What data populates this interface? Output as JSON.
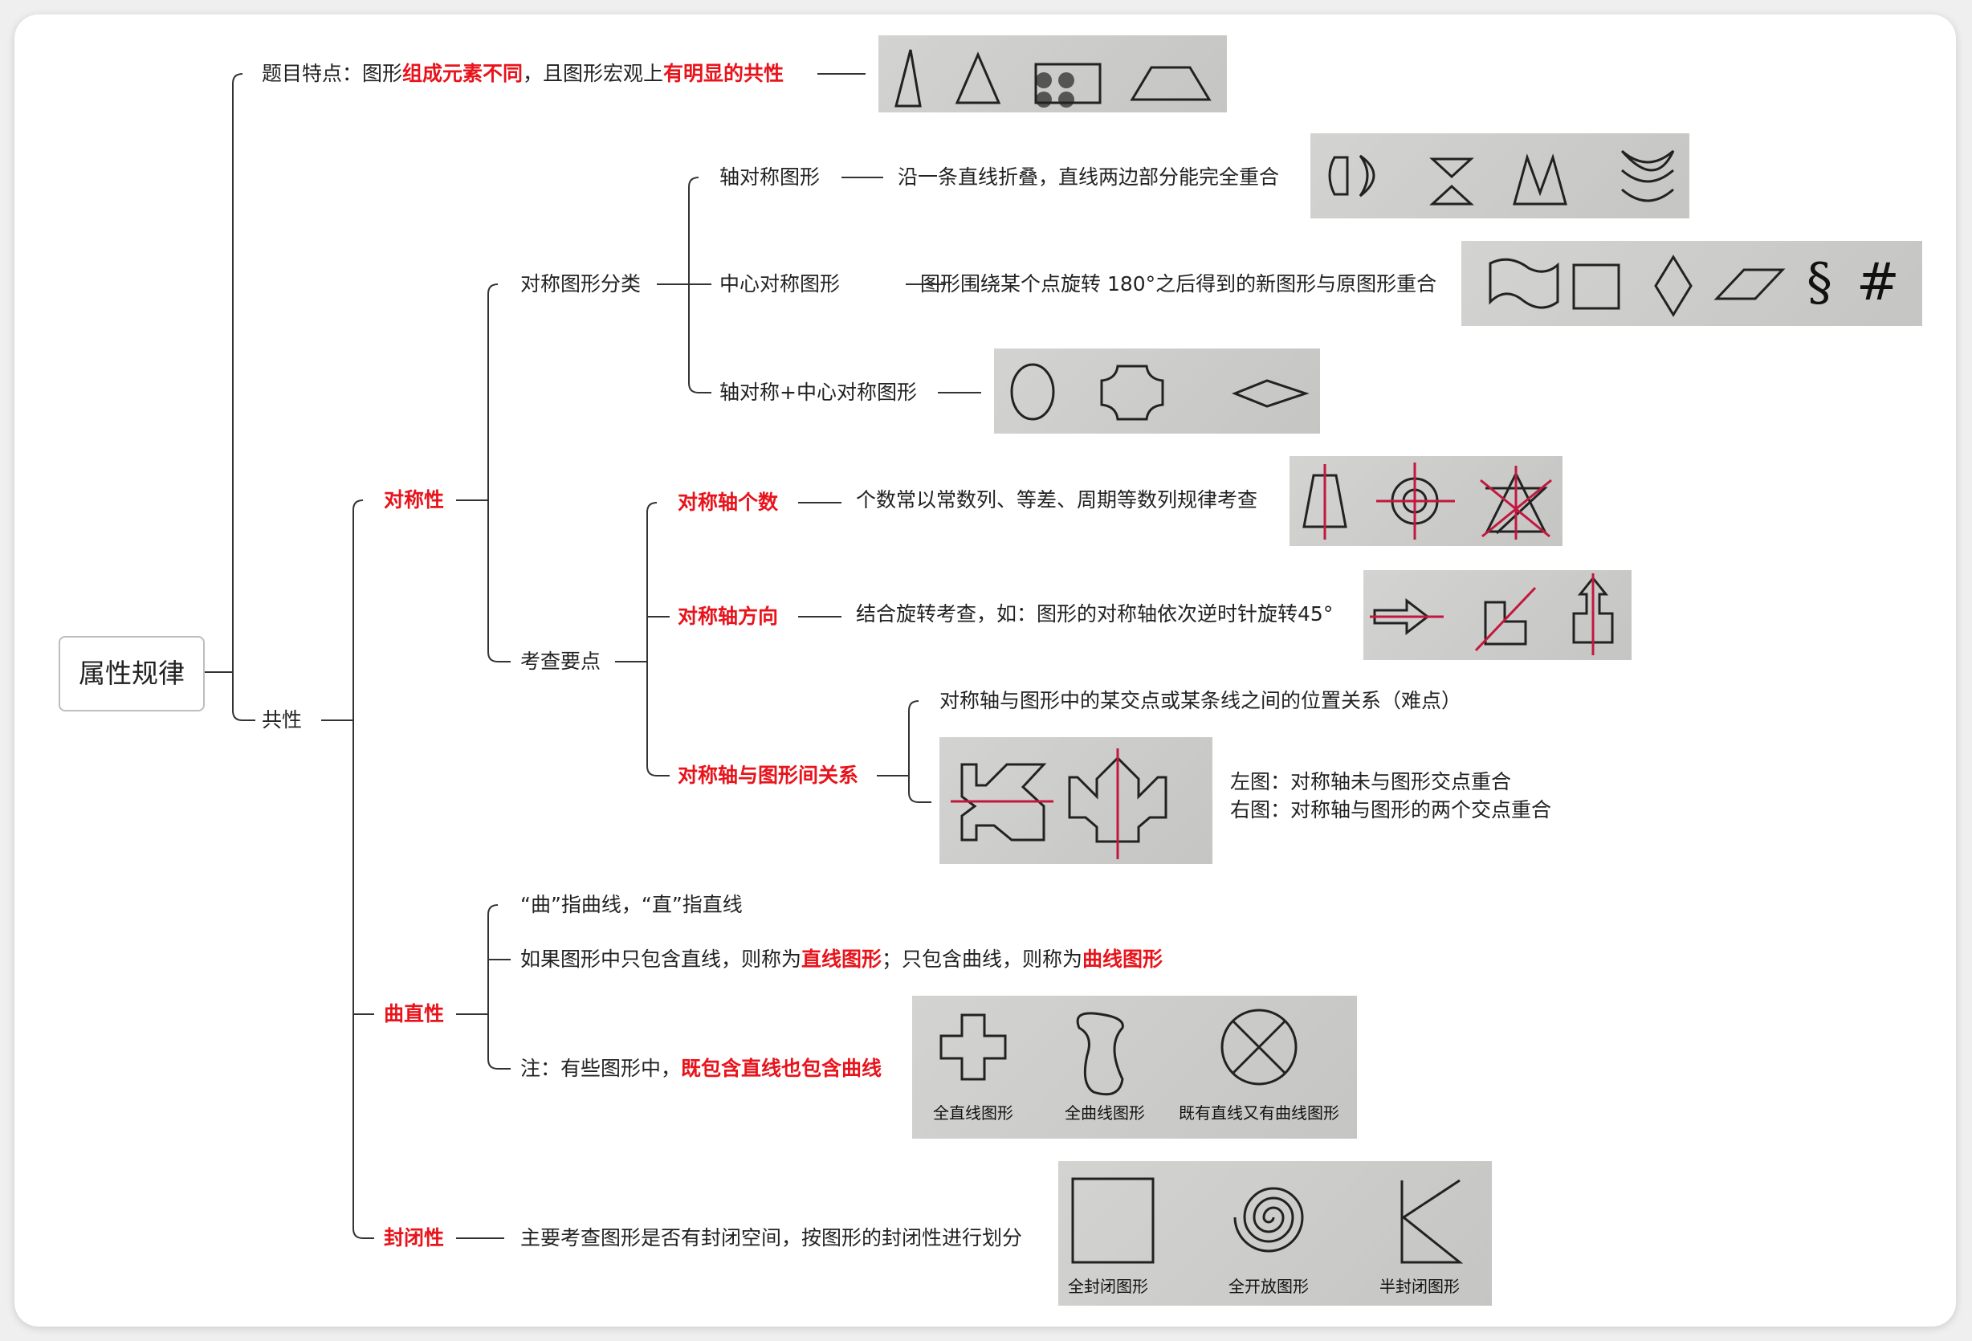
{
  "root": "属性规律",
  "features": {
    "prefix": "题目特点：图形",
    "hl1": "组成元素不同",
    "mid": "，且图形宏观上",
    "hl2": "有明显的共性"
  },
  "gongxing": "共性",
  "symmetry": {
    "label": "对称性",
    "classify": {
      "label": "对称图形分类",
      "axial": {
        "label": "轴对称图形",
        "desc": "沿一条直线折叠，直线两边部分能完全重合"
      },
      "central": {
        "label": "中心对称图形",
        "desc": "图形围绕某个点旋转 180°之后得到的新图形与原图形重合"
      },
      "both": {
        "label": "轴对称+中心对称图形"
      }
    },
    "keypoints": {
      "label": "考查要点",
      "count": {
        "label": "对称轴个数",
        "desc": "个数常以常数列、等差、周期等数列规律考查"
      },
      "direction": {
        "label": "对称轴方向",
        "desc": "结合旋转考查，如：图形的对称轴依次逆时针旋转45°"
      },
      "relation": {
        "label": "对称轴与图形间关系",
        "desc": "对称轴与图形中的某交点或某条线之间的位置关系（难点）",
        "left_note": "左图：对称轴未与图形交点重合",
        "right_note": "右图：对称轴与图形的两个交点重合"
      }
    }
  },
  "curve": {
    "label": "曲直性",
    "note1": "“曲”指曲线，“直”指直线",
    "note2": {
      "prefix": "如果图形中只包含直线，则称为",
      "hl1": "直线图形",
      "mid": "；只包含曲线，则称为",
      "hl2": "曲线图形"
    },
    "note3": {
      "prefix": "注：有些图形中，",
      "hl": "既包含直线也包含曲线"
    },
    "captions": [
      "全直线图形",
      "全曲线图形",
      "既有直线又有曲线图形"
    ]
  },
  "closure": {
    "label": "封闭性",
    "desc": "主要考查图形是否有封闭空间，按图形的封闭性进行划分",
    "captions": [
      "全封闭图形",
      "全开放图形",
      "半封闭图形"
    ]
  },
  "glyphs": {
    "section": "§",
    "hash": "#"
  },
  "colors": {
    "highlight": "#e8131b",
    "axis_line": "#c2183f",
    "connector": "#333333"
  }
}
